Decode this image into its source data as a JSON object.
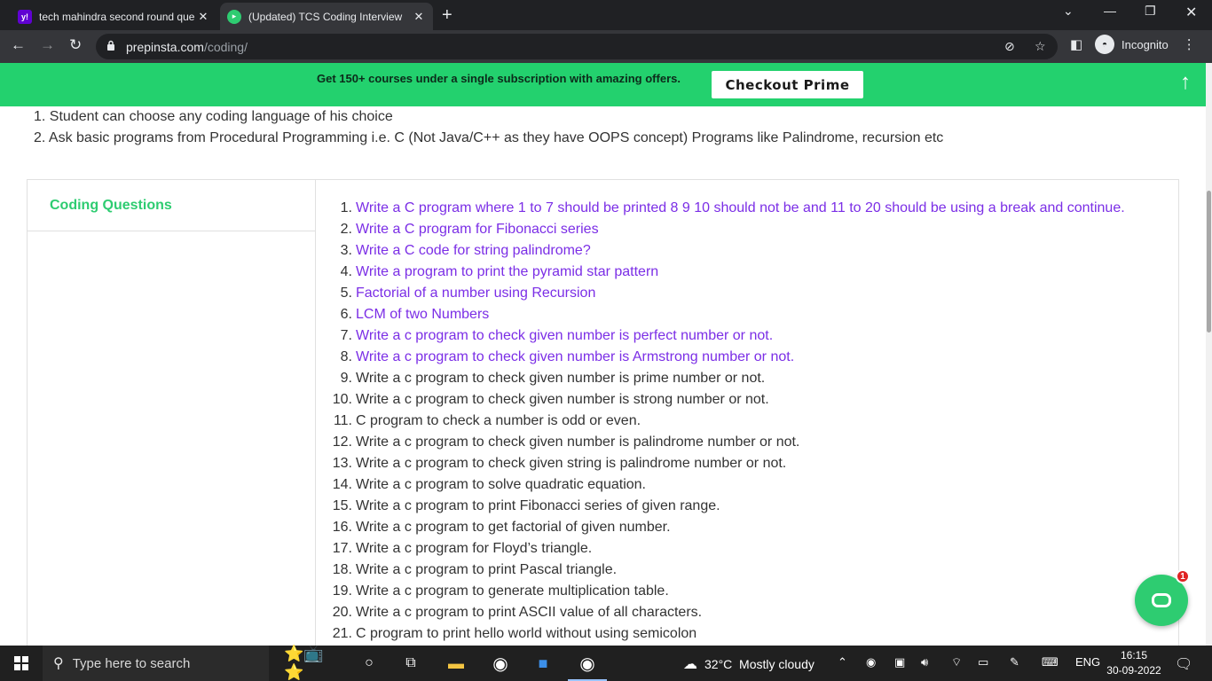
{
  "browser": {
    "tabs": [
      {
        "title": "tech mahindra second round que",
        "favicon": "yahoo-icon",
        "favicon_text": "y!",
        "active": false
      },
      {
        "title": "(Updated) TCS Coding Interview",
        "favicon": "prepinsta-icon",
        "favicon_text": "▸",
        "active": true
      }
    ],
    "url_host": "prepinsta.com",
    "url_path": "/coding/",
    "profile_label": "Incognito"
  },
  "banner": {
    "text": "Get 150+ courses under a single subscription with amazing offers.",
    "button": "Checkout Prime"
  },
  "intro": [
    "1. Student can choose any coding language of his choice",
    "2. Ask basic programs from Procedural Programming i.e. C (Not Java/C++ as they have OOPS concept) Programs like Palindrome, recursion etc"
  ],
  "sidebar": {
    "title": "Coding Questions"
  },
  "questions": [
    {
      "num": "1.",
      "text": "Write a C program where 1 to 7 should be printed 8 9 10 should not be and 11 to 20 should be using a break and continue."
    },
    {
      "num": "2.",
      "text": "Write a C program for Fibonacci series"
    },
    {
      "num": "3.",
      "text": "Write a C code for string palindrome?"
    },
    {
      "num": "4.",
      "text": "Write a program to print the pyramid star pattern"
    },
    {
      "num": "5.",
      "text": "Factorial of a number using Recursion"
    },
    {
      "num": "6.",
      "text": "LCM of two Numbers"
    },
    {
      "num": "7.",
      "text": "Write a c program to check given number is perfect number or not."
    },
    {
      "num": "8.",
      "text": "Write a c program to check given number is Armstrong number or not."
    },
    {
      "num": "9.",
      "text": "Write a c program to check given number is prime number or not."
    },
    {
      "num": "10.",
      "text": "Write a c program to check given number is strong number or not."
    },
    {
      "num": "11.",
      "text": "C program to check a number is odd or even."
    },
    {
      "num": "12.",
      "text": "Write a c program to check given number is palindrome number or not."
    },
    {
      "num": "13.",
      "text": "Write a c program to check given string is palindrome number or not."
    },
    {
      "num": "14.",
      "text": "Write a c program to solve quadratic equation."
    },
    {
      "num": "15.",
      "text": "Write a c program to print Fibonacci series of given range."
    },
    {
      "num": "16.",
      "text": "Write a c program to get factorial of given number."
    },
    {
      "num": "17.",
      "text": "Write a c program for Floyd’s triangle."
    },
    {
      "num": "18.",
      "text": "Write a c program to print Pascal triangle."
    },
    {
      "num": "19.",
      "text": "Write a c program to generate multiplication table."
    },
    {
      "num": "20.",
      "text": "Write a c program to print ASCII value of all characters."
    },
    {
      "num": "21.",
      "text": "C program to print hello world without using semicolon"
    }
  ],
  "linked_count": 8,
  "chat": {
    "badge": "1"
  },
  "taskbar": {
    "search_placeholder": "Type here to search",
    "weather": "32°C  Mostly cloudy",
    "language": "ENG",
    "time": "16:15",
    "date": "30-09-2022"
  },
  "colors": {
    "banner": "#23d16e",
    "link": "#7b2ee6",
    "accent": "#2ecc71"
  }
}
